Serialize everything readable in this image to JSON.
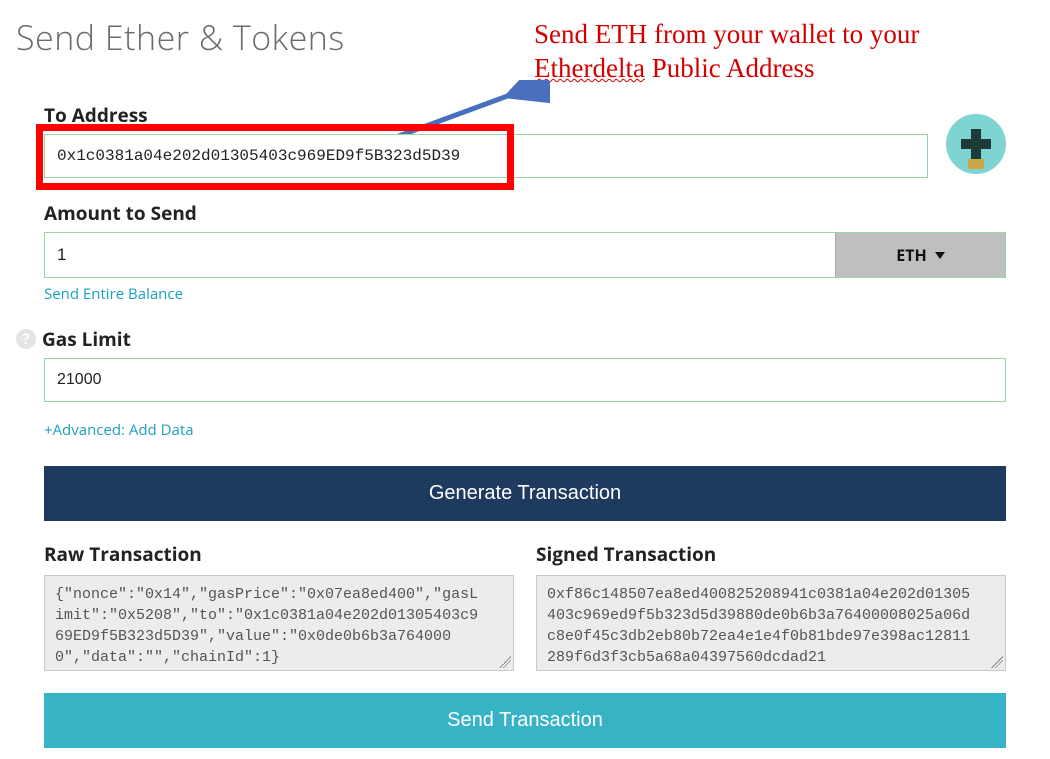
{
  "page": {
    "title": "Send Ether & Tokens"
  },
  "annotation": {
    "line1": "Send ETH from your wallet to your",
    "word_squiggle": "Etherdelta",
    "line2_rest": " Public Address"
  },
  "to_address": {
    "label": "To Address",
    "value": "0x1c0381a04e202d01305403c969ED9f5B323d5D39"
  },
  "amount": {
    "label": "Amount to Send",
    "value": "1",
    "unit": "ETH",
    "entire_balance_label": "Send Entire Balance"
  },
  "gas": {
    "label": "Gas Limit",
    "value": "21000"
  },
  "advanced_link": "+Advanced: Add Data",
  "generate_btn": "Generate Transaction",
  "raw": {
    "label": "Raw Transaction",
    "value": "{\"nonce\":\"0x14\",\"gasPrice\":\"0x07ea8ed400\",\"gasLimit\":\"0x5208\",\"to\":\"0x1c0381a04e202d01305403c969ED9f5B323d5D39\",\"value\":\"0x0de0b6b3a7640000\",\"data\":\"\",\"chainId\":1}"
  },
  "signed": {
    "label": "Signed Transaction",
    "value": "0xf86c148507ea8ed400825208941c0381a04e202d01305403c969ed9f5b323d5d39880de0b6b3a76400008025a06dc8e0f45c3db2eb80b72ea4e1e4f0b81bde97e398ac12811289f6d3f3cb5a68a04397560dcdad21"
  },
  "send_btn": "Send Transaction"
}
